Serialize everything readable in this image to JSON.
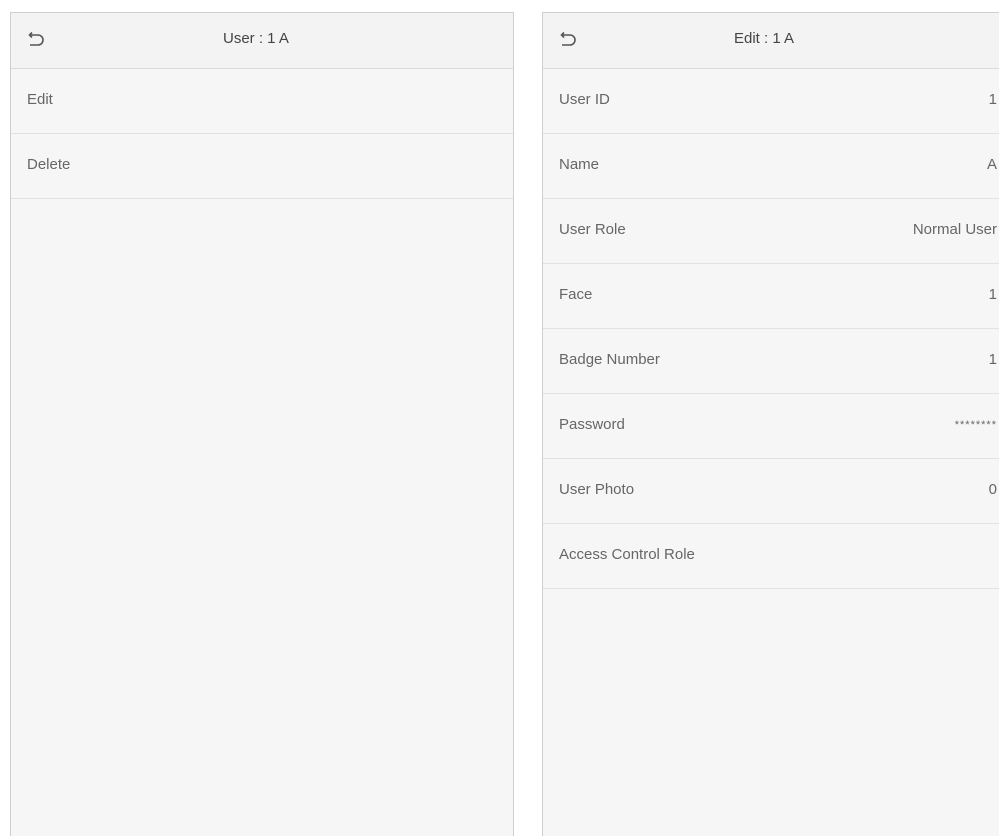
{
  "left_panel": {
    "title": "User : 1 A",
    "back_icon": "back-arrow-icon",
    "menu_items": [
      {
        "label": "Edit"
      },
      {
        "label": "Delete"
      }
    ]
  },
  "right_panel": {
    "title": "Edit : 1 A",
    "back_icon": "back-arrow-icon",
    "fields": [
      {
        "label": "User ID",
        "value": "1"
      },
      {
        "label": "Name",
        "value": "A"
      },
      {
        "label": "User Role",
        "value": "Normal User"
      },
      {
        "label": "Face",
        "value": "1"
      },
      {
        "label": "Badge Number",
        "value": "1"
      },
      {
        "label": "Password",
        "value": "********"
      },
      {
        "label": "User Photo",
        "value": "0"
      },
      {
        "label": "Access Control Role",
        "value": ""
      }
    ]
  },
  "colors": {
    "panel_background": "#f6f6f6",
    "divider": "#e2e2e2",
    "text": "#666666"
  }
}
